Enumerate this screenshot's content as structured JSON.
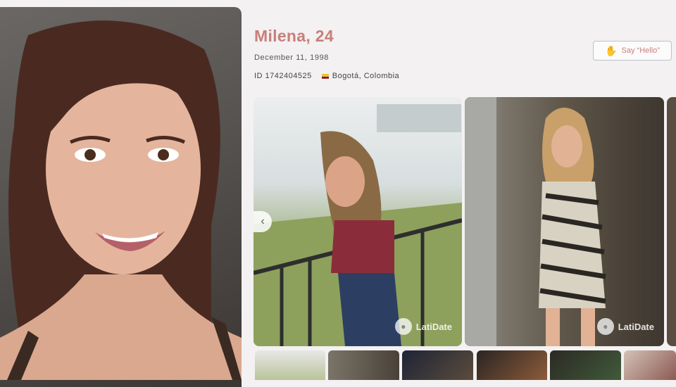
{
  "profile": {
    "name_age": "Milena, 24",
    "birth_date": "December 11, 1998",
    "id_text": "ID 1742404525",
    "location": "Bogotá, Colombia"
  },
  "actions": {
    "say_hello_label": "Say “Hello”"
  },
  "gallery": {
    "watermark": "LatiDate",
    "prev_arrow": "‹"
  },
  "colors": {
    "accent": "#c97f7a",
    "flag": [
      "#f2c12e",
      "#1f3b8f",
      "#c8262e"
    ]
  }
}
